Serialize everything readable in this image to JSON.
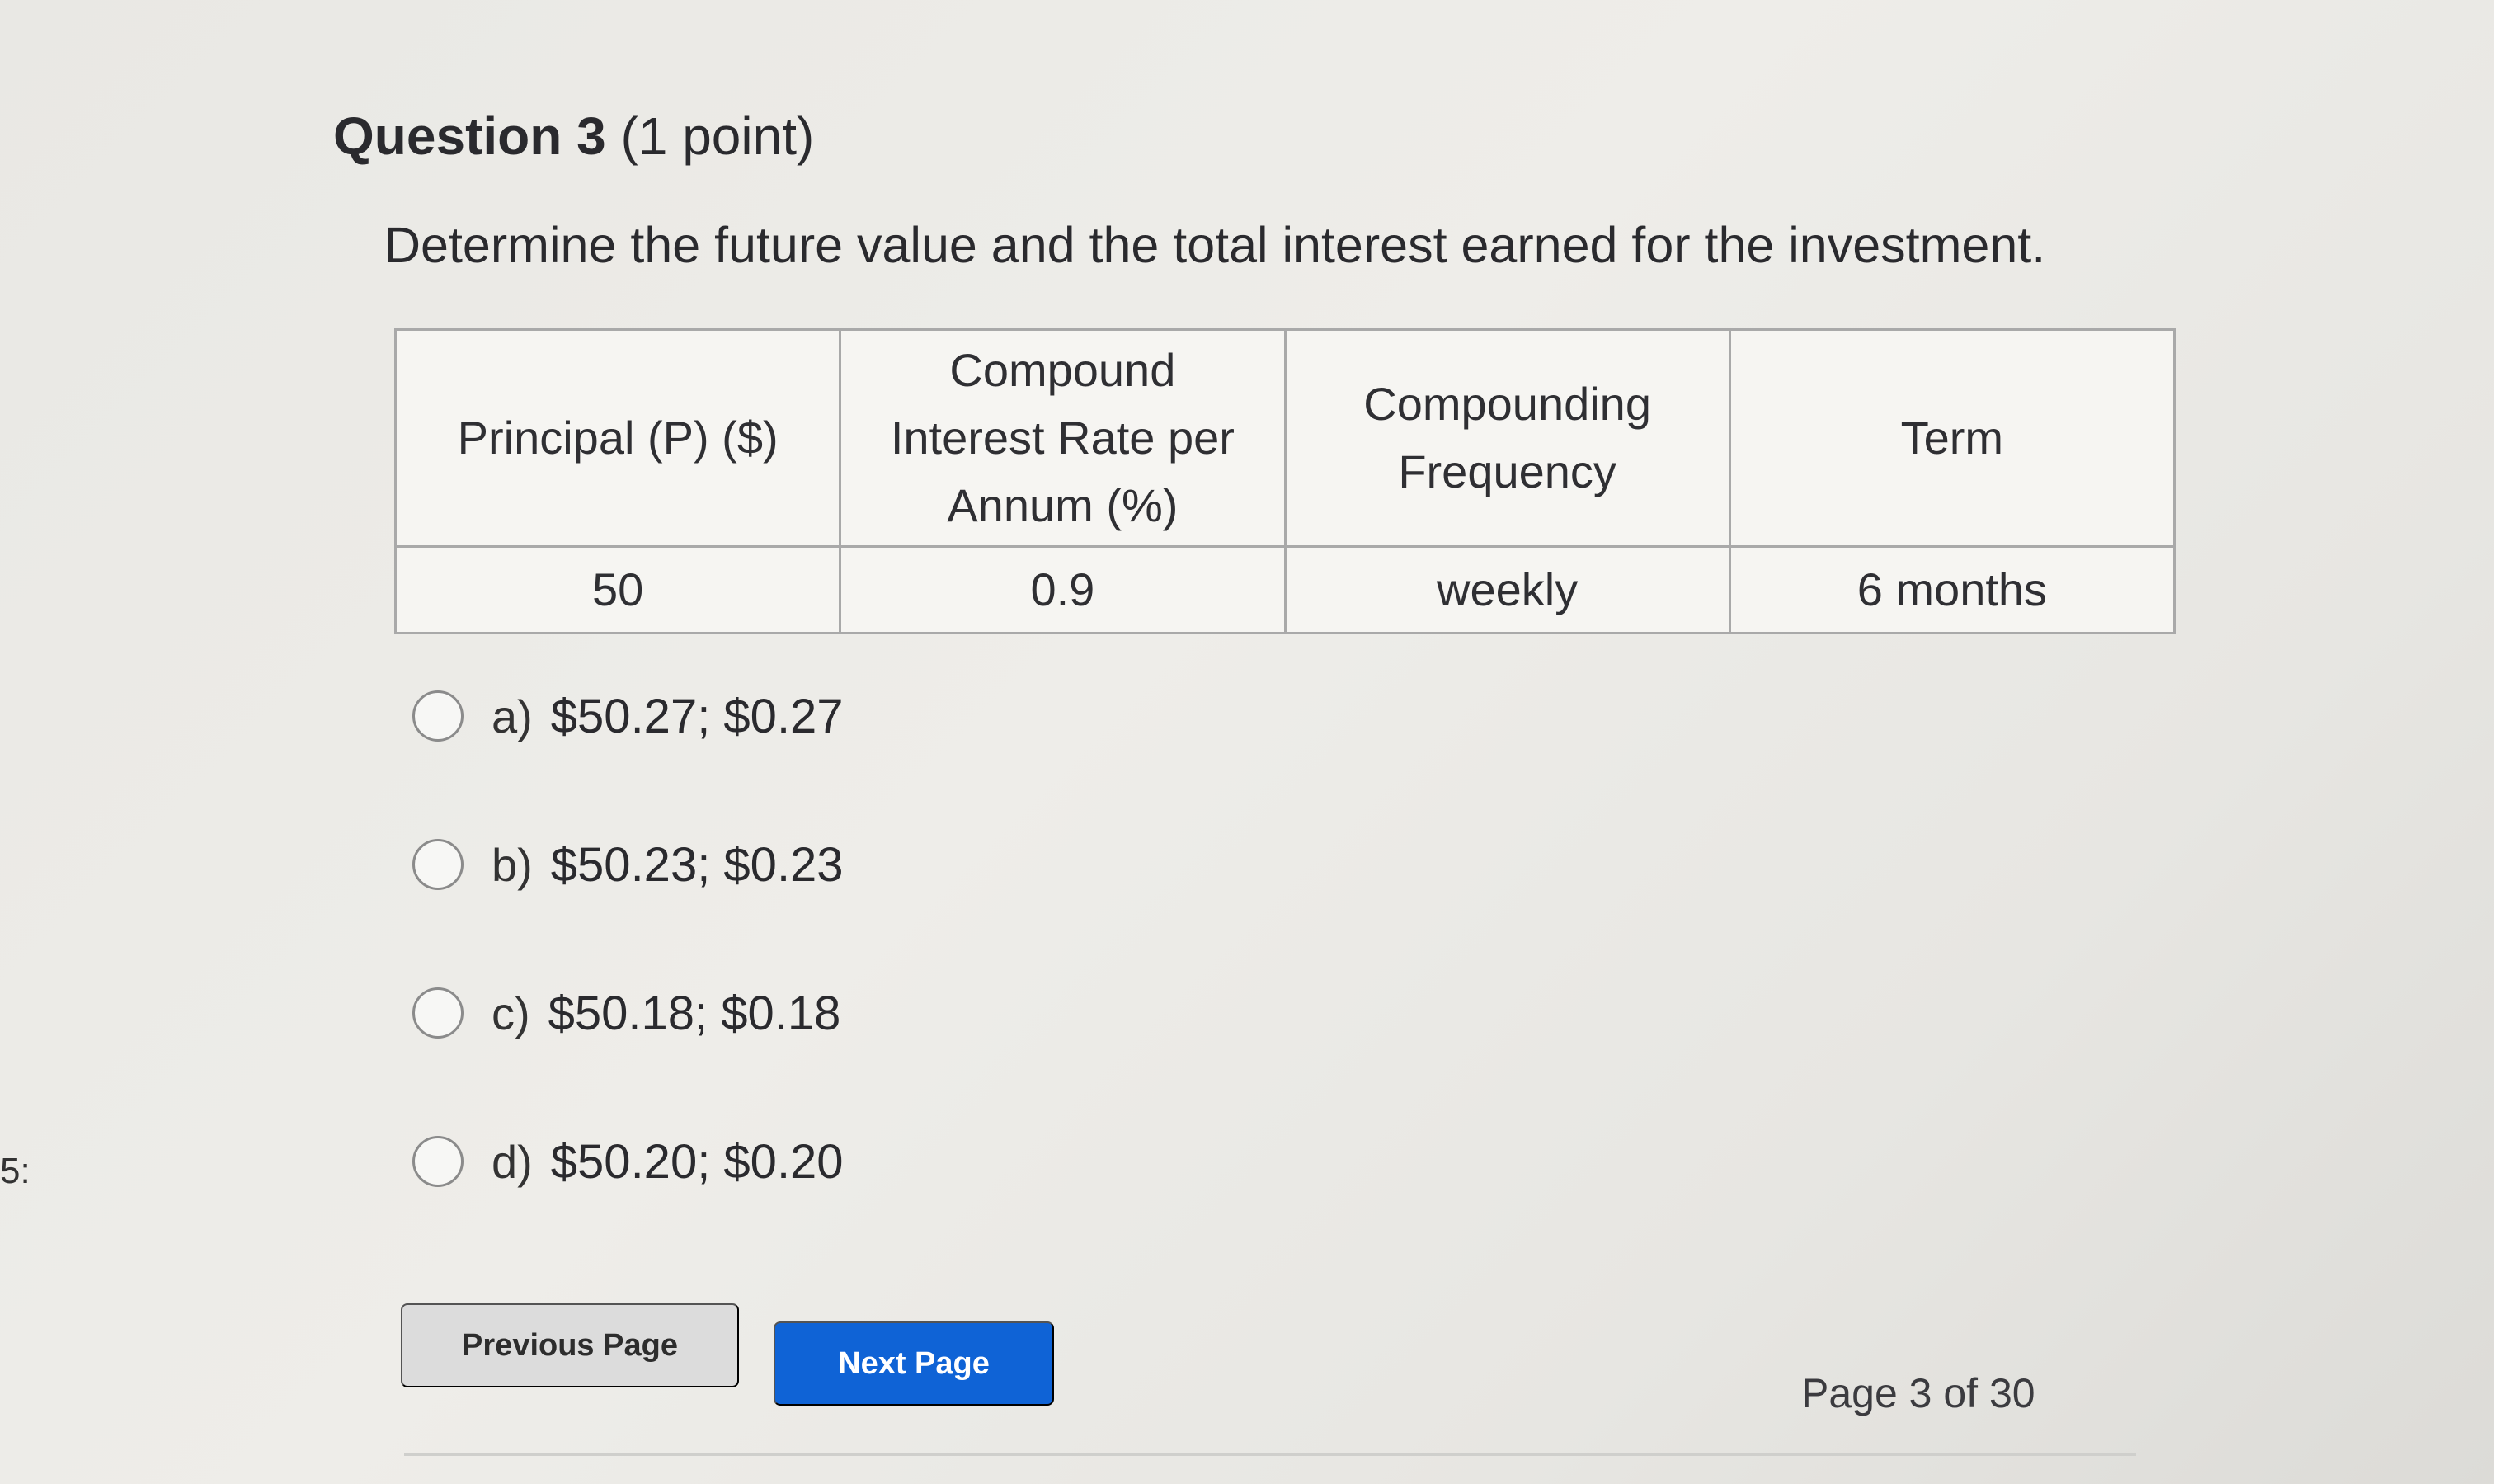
{
  "edge_mark": "5:",
  "question": {
    "title_bold": "Question 3",
    "title_points": "(1 point)",
    "prompt": "Determine the future value and the total interest earned for the investment."
  },
  "table": {
    "headers": [
      "Principal (P) ($)",
      "Compound Interest Rate per Annum (%)",
      "Compounding Frequency",
      "Term"
    ],
    "row": [
      "50",
      "0.9",
      "weekly",
      "6 months"
    ]
  },
  "options": [
    {
      "letter": "a)",
      "text": "$50.27; $0.27"
    },
    {
      "letter": "b)",
      "text": "$50.23; $0.23"
    },
    {
      "letter": "c)",
      "text": "$50.18; $0.18"
    },
    {
      "letter": "d)",
      "text": "$50.20; $0.20"
    }
  ],
  "buttons": {
    "previous": "Previous Page",
    "next": "Next Page"
  },
  "page_indicator": "Page 3 of 30",
  "colors": {
    "primary_button": "#0f63d6",
    "secondary_button": "#dcdcdc"
  }
}
